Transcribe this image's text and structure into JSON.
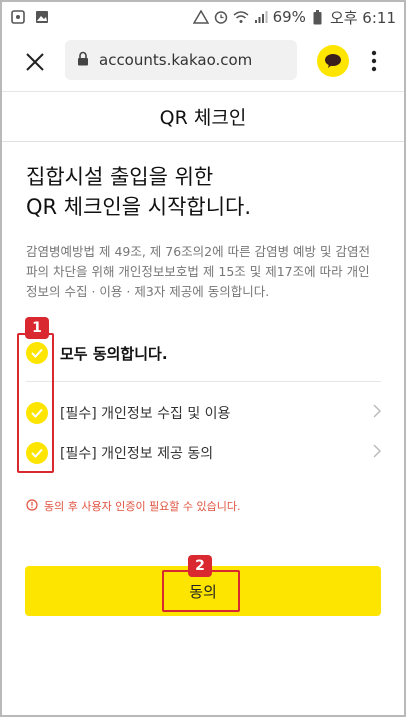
{
  "status_bar": {
    "battery": "69%",
    "time": "오후 6:11",
    "icons": [
      "notification-icon",
      "image-icon",
      "alert-icon",
      "alarm-icon",
      "wifi-icon",
      "signal-icon",
      "battery-icon"
    ]
  },
  "browser": {
    "url": "accounts.kakao.com",
    "icons": [
      "close-icon",
      "lock-icon",
      "kakaotalk-icon",
      "more-icon"
    ]
  },
  "page": {
    "title": "QR 체크인",
    "headline_line1": "집합시설 출입을 위한",
    "headline_line2": "QR 체크인을 시작합니다.",
    "description": "감염병예방법 제 49조, 제 76조의2에 따른 감염병 예방 및 감염전파의 차단을 위해 개인정보보호법 제 15조 및 제17조에 따라 개인정보의 수집 · 이용 · 제3자 제공에 동의합니다.",
    "agree_all_label": "모두 동의합니다.",
    "items": [
      {
        "label": "[필수] 개인정보 수집 및 이용"
      },
      {
        "label": "[필수] 개인정보 제공 동의"
      }
    ],
    "notice": "동의 후 사용자 인증이 필요할 수 있습니다.",
    "agree_button": "동의"
  },
  "annotations": {
    "badge1": "1",
    "badge2": "2"
  },
  "colors": {
    "kakao_yellow": "#fee500",
    "annotation_red": "#d9282f",
    "notice_red": "#e0523f"
  }
}
